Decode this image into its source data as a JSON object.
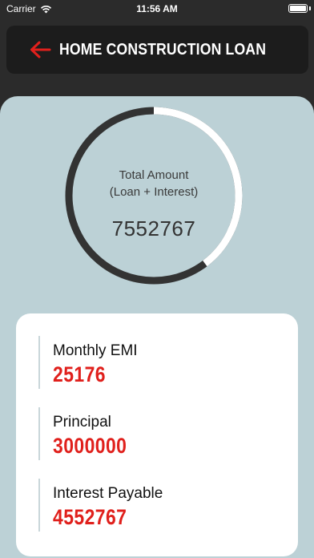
{
  "status_bar": {
    "carrier": "Carrier",
    "time": "11:56 AM"
  },
  "header": {
    "title": "HOME CONSTRUCTION LOAN"
  },
  "summary": {
    "label_line1": "Total Amount",
    "label_line2": "(Loan + Interest)",
    "total": "7552767",
    "principal_fraction": 0.397
  },
  "details": [
    {
      "label": "Monthly EMI",
      "value": "25176"
    },
    {
      "label": "Principal",
      "value": "3000000"
    },
    {
      "label": "Interest Payable",
      "value": "4552767"
    }
  ],
  "colors": {
    "accent_red": "#e0201c",
    "ring_dark": "#333333",
    "ring_light": "#ffffff",
    "panel": "#bcd1d6"
  }
}
